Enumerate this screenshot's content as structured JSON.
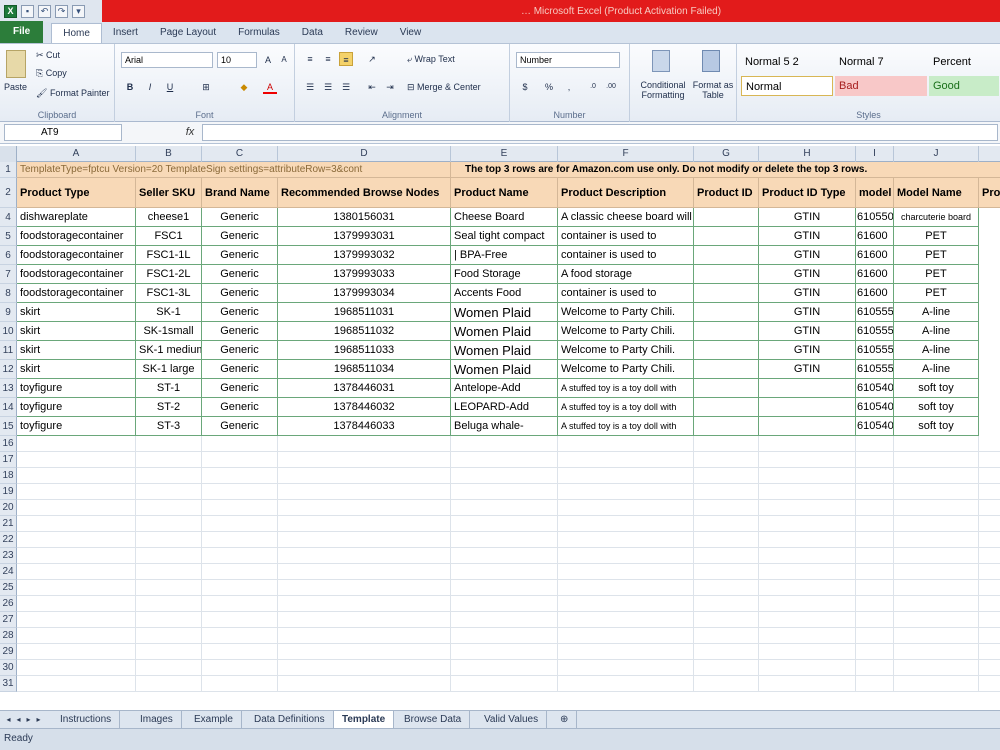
{
  "window": {
    "title": "… Microsoft Excel (Product Activation Failed)"
  },
  "ribbon": {
    "tabs": [
      "File",
      "Home",
      "Insert",
      "Page Layout",
      "Formulas",
      "Data",
      "Review",
      "View"
    ],
    "clipboard": {
      "cut": "Cut",
      "copy": "Copy",
      "paste": "Paste",
      "format_painter": "Format Painter",
      "label": "Clipboard"
    },
    "font": {
      "name": "Arial",
      "size": "10",
      "label": "Font"
    },
    "alignment": {
      "wrap": "Wrap Text",
      "merge": "Merge & Center",
      "label": "Alignment"
    },
    "number": {
      "format": "Number",
      "label": "Number"
    },
    "conditional": "Conditional Formatting",
    "format_table": "Format as Table",
    "styles": {
      "label": "Styles",
      "s1": "Normal 5 2",
      "s2": "Normal 7",
      "s3": "Percent",
      "s4": "Normal",
      "s5": "Bad",
      "s6": "Good"
    }
  },
  "formula_bar": {
    "name_box": "AT9",
    "fx": "fx"
  },
  "columns": [
    "A",
    "B",
    "C",
    "D",
    "E",
    "F",
    "G",
    "H",
    "I",
    "J"
  ],
  "sheet": {
    "row1_meta": "TemplateType=fptcu  Version=20  TemplateSign  settings=attributeRow=3&cont",
    "row1_notice": "The top 3 rows are for Amazon.com use only. Do not modify or delete the top 3 rows.",
    "headers": [
      "Product Type",
      "Seller SKU",
      "Brand Name",
      "Recommended Browse Nodes",
      "Product Name",
      "Product Description",
      "Product ID",
      "Product ID Type",
      "model",
      "Model Name",
      "Pro"
    ],
    "rows": [
      {
        "n": "4",
        "cells": [
          "dishwareplate",
          "cheese1",
          "Generic",
          "1380156031",
          "Cheese        Board",
          "A classic cheese board will contain a cheese from",
          "",
          "GTIN",
          "610550",
          "charcuterie board"
        ]
      },
      {
        "n": "5",
        "cells": [
          "foodstoragecontainer",
          "FSC1",
          "Generic",
          "1379993031",
          "Seal tight compact",
          "container is used to",
          "",
          "GTIN",
          "61600",
          "PET"
        ]
      },
      {
        "n": "6",
        "cells": [
          "foodstoragecontainer",
          "FSC1-1L",
          "Generic",
          "1379993032",
          "| BPA-Free",
          "container is used to",
          "",
          "GTIN",
          "61600",
          "PET"
        ]
      },
      {
        "n": "7",
        "cells": [
          "foodstoragecontainer",
          "FSC1-2L",
          "Generic",
          "1379993033",
          "Food Storage",
          "A food storage",
          "",
          "GTIN",
          "61600",
          "PET"
        ]
      },
      {
        "n": "8",
        "cells": [
          "foodstoragecontainer",
          "FSC1-3L",
          "Generic",
          "1379993034",
          "Accents Food",
          "container is used to",
          "",
          "GTIN",
          "61600",
          "PET"
        ]
      },
      {
        "n": "9",
        "cells": [
          "skirt",
          "SK-1",
          "Generic",
          "1968511031",
          "Women Plaid",
          "Welcome to Party Chili.",
          "",
          "GTIN",
          "610555",
          "A-line"
        ]
      },
      {
        "n": "10",
        "cells": [
          "skirt",
          "SK-1small",
          "Generic",
          "1968511032",
          "Women Plaid",
          "Welcome to Party Chili.",
          "",
          "GTIN",
          "610555",
          "A-line"
        ]
      },
      {
        "n": "11",
        "cells": [
          "skirt",
          "SK-1 medium",
          "Generic",
          "1968511033",
          "Women Plaid",
          "Welcome to Party Chili.",
          "",
          "GTIN",
          "610555",
          "A-line"
        ]
      },
      {
        "n": "12",
        "cells": [
          "skirt",
          "SK-1 large",
          "Generic",
          "1968511034",
          "Women Plaid",
          "Welcome to Party Chili.",
          "",
          "GTIN",
          "610555",
          "A-line"
        ]
      },
      {
        "n": "13",
        "cells": [
          "toyfigure",
          "ST-1",
          "Generic",
          "1378446031",
          "Antelope-Add",
          "A stuffed toy is a toy doll with",
          "",
          "",
          "610540",
          "soft toy"
        ]
      },
      {
        "n": "14",
        "cells": [
          "toyfigure",
          "ST-2",
          "Generic",
          "1378446032",
          "LEOPARD-Add",
          "A stuffed toy is a toy doll with",
          "",
          "",
          "610540",
          "soft toy"
        ]
      },
      {
        "n": "15",
        "cells": [
          "toyfigure",
          "ST-3",
          "Generic",
          "1378446033",
          "Beluga whale-",
          "A stuffed toy is a toy doll with",
          "",
          "",
          "610540",
          "soft toy"
        ]
      }
    ],
    "empty_rows": [
      "16",
      "17",
      "18",
      "19",
      "20",
      "21",
      "22",
      "23",
      "24",
      "25",
      "26",
      "27",
      "28",
      "29",
      "30",
      "31"
    ]
  },
  "sheet_tabs": [
    "Instructions",
    "Images",
    "Example",
    "Data Definitions",
    "Template",
    "Browse Data",
    "Valid Values"
  ],
  "active_sheet": "Template",
  "status": "Ready"
}
